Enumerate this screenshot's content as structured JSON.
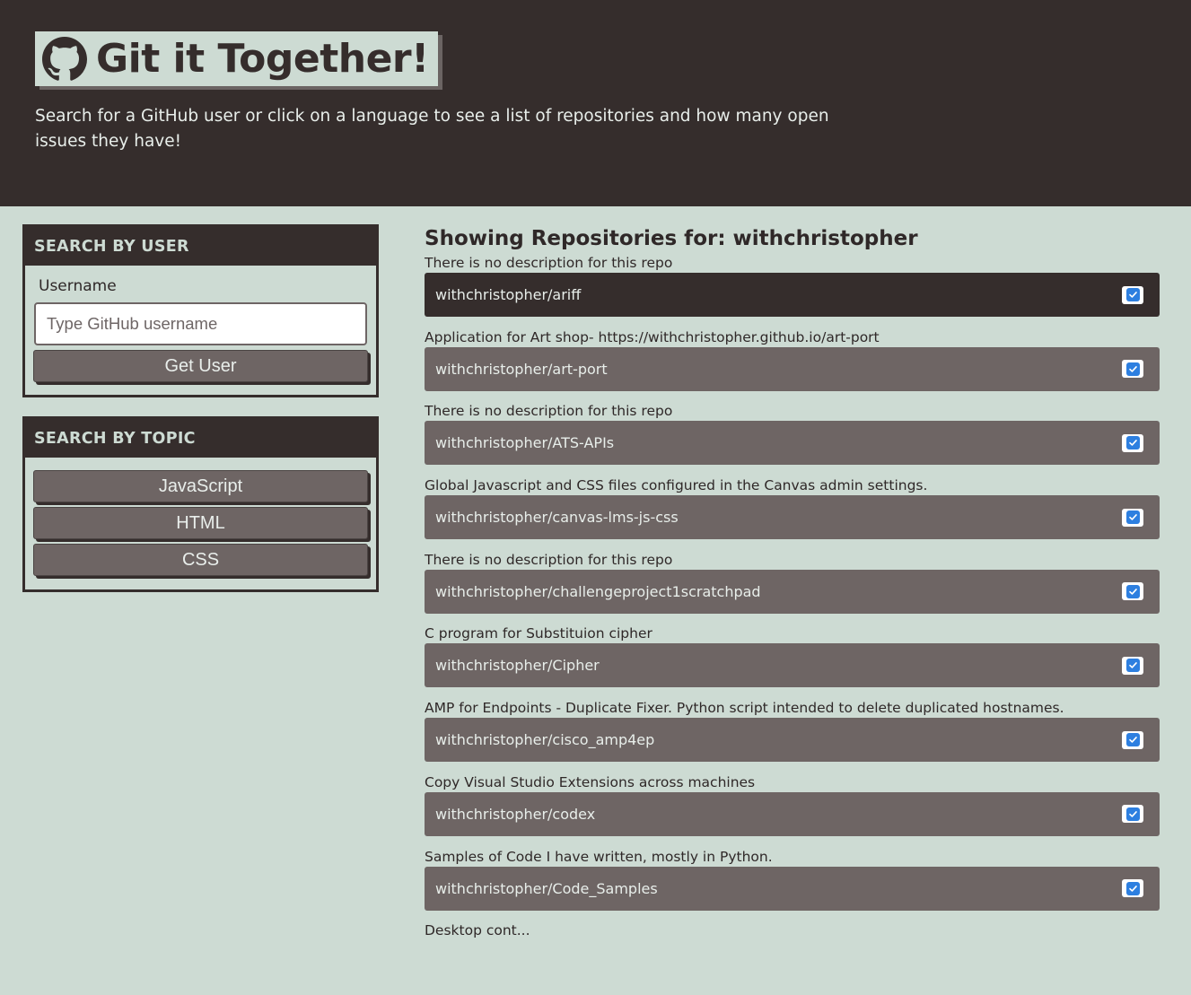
{
  "header": {
    "title": "Git it Together!",
    "subtitle": "Search for a GitHub user or click on a language to see a list of repositories and how many open issues they have!",
    "logo_icon": "github-icon"
  },
  "user_search": {
    "heading": "SEARCH BY USER",
    "label": "Username",
    "placeholder": "Type GitHub username",
    "button": "Get User"
  },
  "topic_search": {
    "heading": "SEARCH BY TOPIC",
    "languages": [
      "JavaScript",
      "HTML",
      "CSS"
    ]
  },
  "results": {
    "title_prefix": "Showing Repositories for: ",
    "username": "withchristopher",
    "repos": [
      {
        "desc": "There is no description for this repo",
        "name": "withchristopher/ariff",
        "checked": true
      },
      {
        "desc": "Application for Art shop- https://withchristopher.github.io/art-port",
        "name": "withchristopher/art-port",
        "checked": true
      },
      {
        "desc": "There is no description for this repo",
        "name": "withchristopher/ATS-APIs",
        "checked": true
      },
      {
        "desc": "Global Javascript and CSS files configured in the Canvas admin settings.",
        "name": "withchristopher/canvas-lms-js-css",
        "checked": true
      },
      {
        "desc": "There is no description for this repo",
        "name": "withchristopher/challengeproject1scratchpad",
        "checked": true
      },
      {
        "desc": "C program for Substituion cipher",
        "name": "withchristopher/Cipher",
        "checked": true
      },
      {
        "desc": "AMP for Endpoints - Duplicate Fixer. Python script intended to delete duplicated hostnames.",
        "name": "withchristopher/cisco_amp4ep",
        "checked": true
      },
      {
        "desc": "Copy Visual Studio Extensions across machines",
        "name": "withchristopher/codex",
        "checked": true
      },
      {
        "desc": "Samples of Code I have written, mostly in Python.",
        "name": "withchristopher/Code_Samples",
        "checked": true
      },
      {
        "desc": "Desktop cont...",
        "name": "",
        "checked": false
      }
    ]
  },
  "colors": {
    "dark": "#352d2c",
    "muted": "#6e6564",
    "background": "#cddbd3",
    "checkbox": "#2d7fe0"
  }
}
